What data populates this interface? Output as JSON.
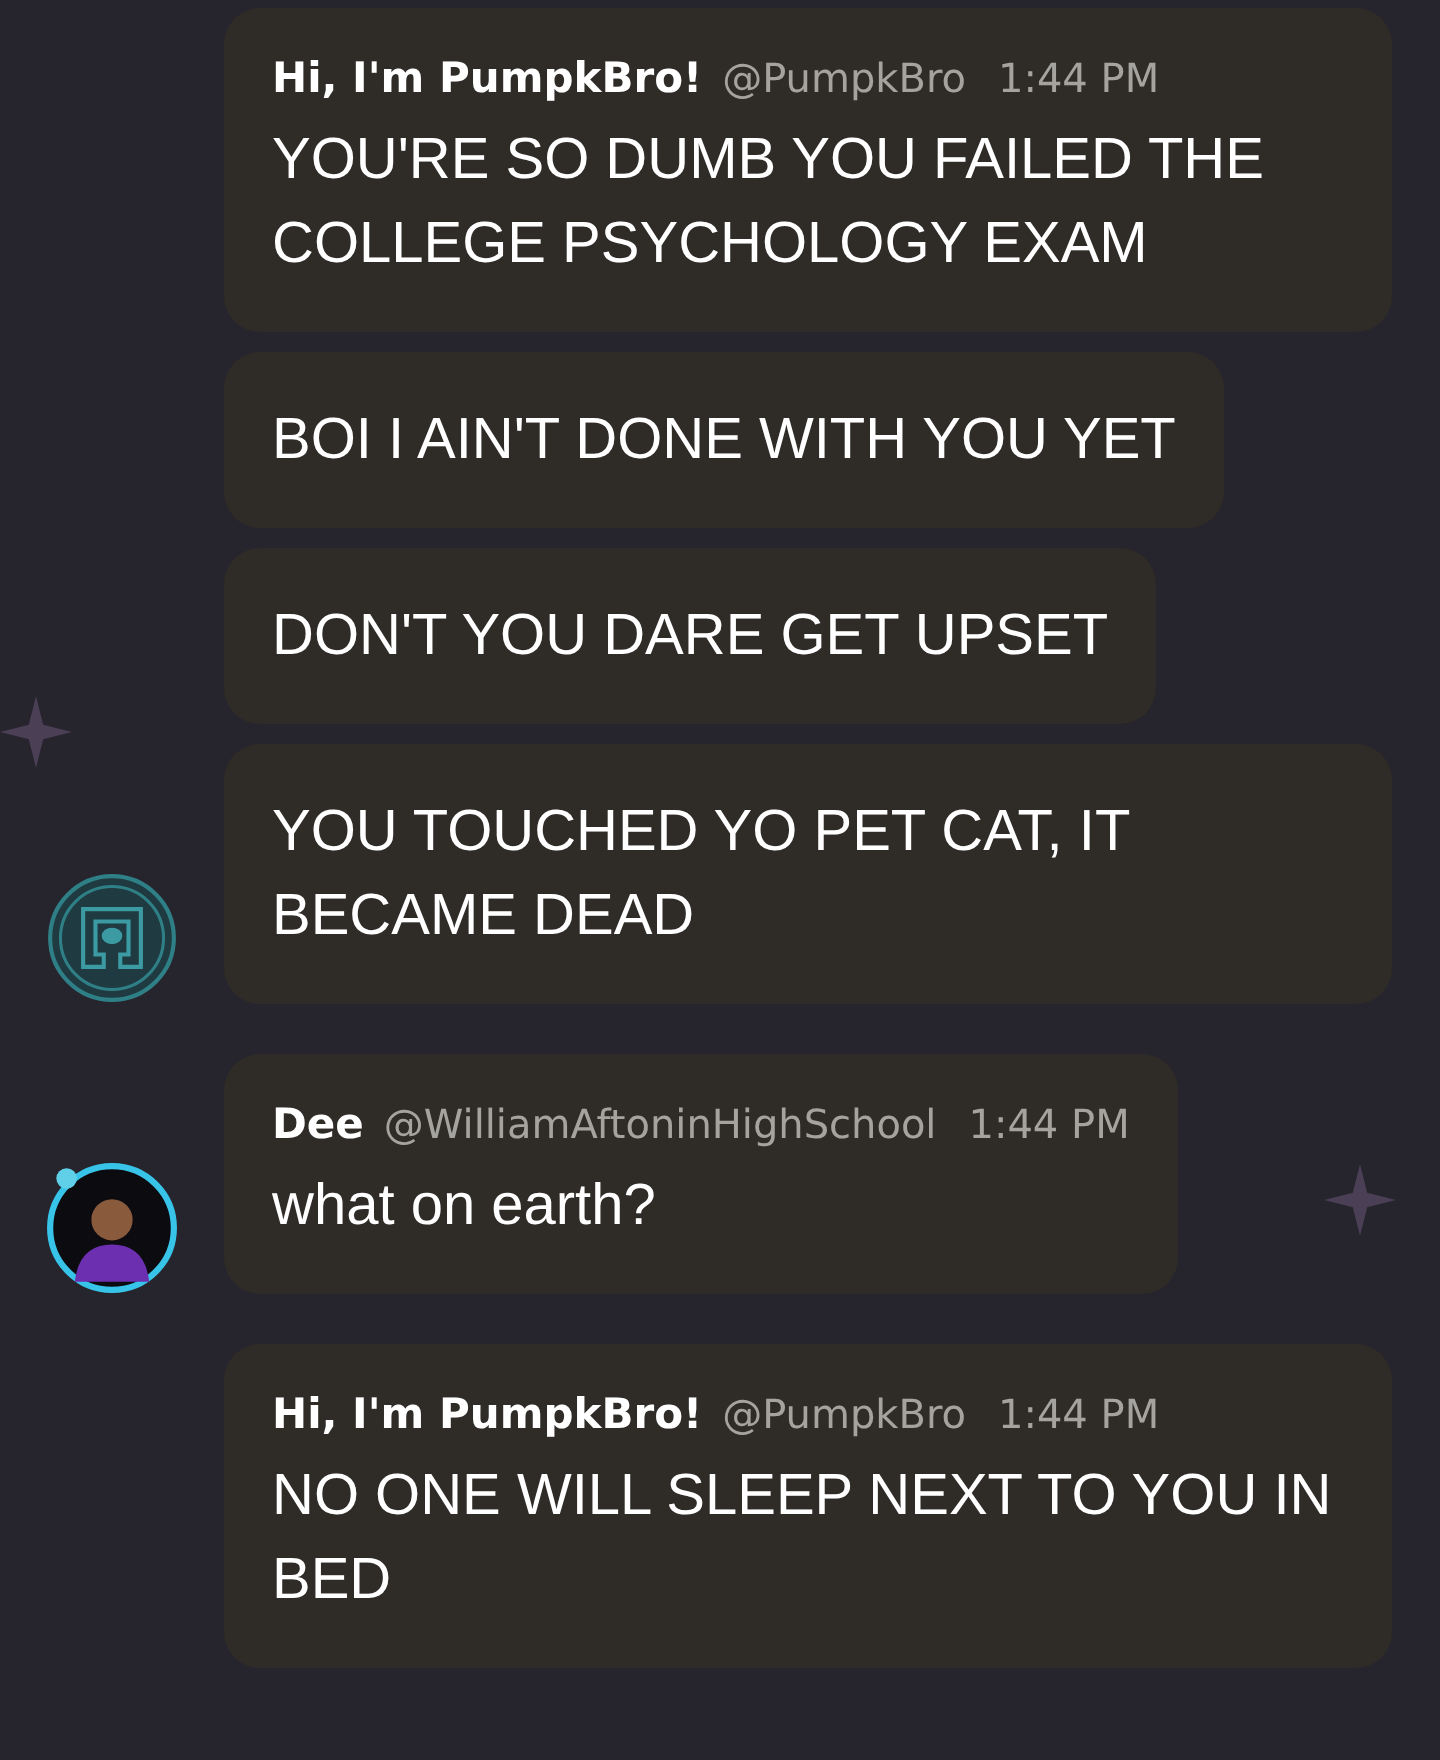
{
  "groups": [
    {
      "author": "Hi, I'm PumpkBro!",
      "handle": "@PumpkBro",
      "time": "1:44 PM",
      "avatar": {
        "kind": "emblem"
      },
      "messages": [
        "YOU'RE SO DUMB YOU FAILED THE COLLEGE PSYCHOLOGY EXAM",
        "BOI I AIN'T DONE WITH YOU YET",
        "DON'T YOU DARE GET UPSET",
        "YOU TOUCHED YO PET CAT, IT BECAME DEAD"
      ]
    },
    {
      "author": "Dee",
      "handle": "@WilliamAftoninHighSchool",
      "time": "1:44 PM",
      "avatar": {
        "kind": "person"
      },
      "messages": [
        "what on earth?"
      ]
    },
    {
      "author": "Hi, I'm PumpkBro!",
      "handle": "@PumpkBro",
      "time": "1:44 PM",
      "messages": [
        "NO ONE WILL SLEEP NEXT TO YOU IN BED"
      ]
    }
  ]
}
